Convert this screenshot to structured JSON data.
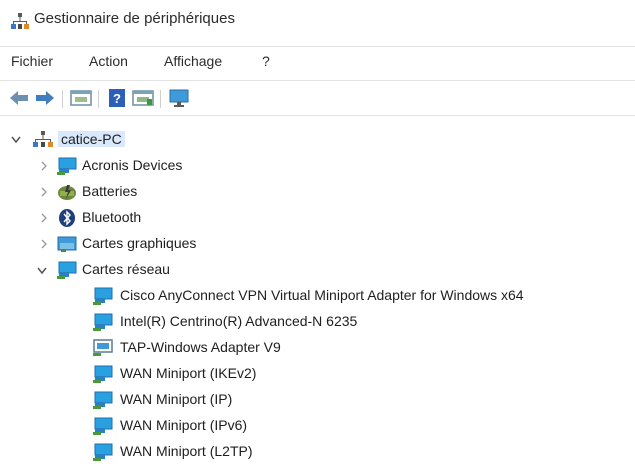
{
  "window": {
    "title": "Gestionnaire de périphériques",
    "icon": "device-manager-icon"
  },
  "menu": [
    "Fichier",
    "Action",
    "Affichage",
    "?"
  ],
  "toolbar": {
    "buttons": [
      "back-arrow-icon",
      "forward-arrow-icon",
      "properties-icon",
      "help-icon",
      "update-driver-icon",
      "scan-hardware-icon"
    ]
  },
  "tree": {
    "root": {
      "label": "catice-PC",
      "icon": "computer-icon",
      "expanded": true
    },
    "categories": [
      {
        "label": "Acronis Devices",
        "icon": "network-adapter-icon",
        "expanded": false
      },
      {
        "label": "Batteries",
        "icon": "battery-icon",
        "expanded": false
      },
      {
        "label": "Bluetooth",
        "icon": "bluetooth-icon",
        "expanded": false
      },
      {
        "label": "Cartes graphiques",
        "icon": "display-adapter-icon",
        "expanded": false
      },
      {
        "label": "Cartes réseau",
        "icon": "network-adapter-icon",
        "expanded": true
      }
    ],
    "network_devices": [
      {
        "label": "Cisco AnyConnect VPN Virtual Miniport Adapter for Windows x64",
        "icon": "network-adapter-icon"
      },
      {
        "label": "Intel(R) Centrino(R) Advanced-N 6235",
        "icon": "network-adapter-icon"
      },
      {
        "label": "TAP-Windows Adapter V9",
        "icon": "network-adapter-icon"
      },
      {
        "label": "WAN Miniport (IKEv2)",
        "icon": "network-adapter-icon"
      },
      {
        "label": "WAN Miniport (IP)",
        "icon": "network-adapter-icon"
      },
      {
        "label": "WAN Miniport (IPv6)",
        "icon": "network-adapter-icon"
      },
      {
        "label": "WAN Miniport (L2TP)",
        "icon": "network-adapter-icon"
      }
    ]
  },
  "colors": {
    "selection": "#d9e9fb",
    "adapter_icon": "#1f8fd6",
    "separator": "#e3e3e3"
  }
}
